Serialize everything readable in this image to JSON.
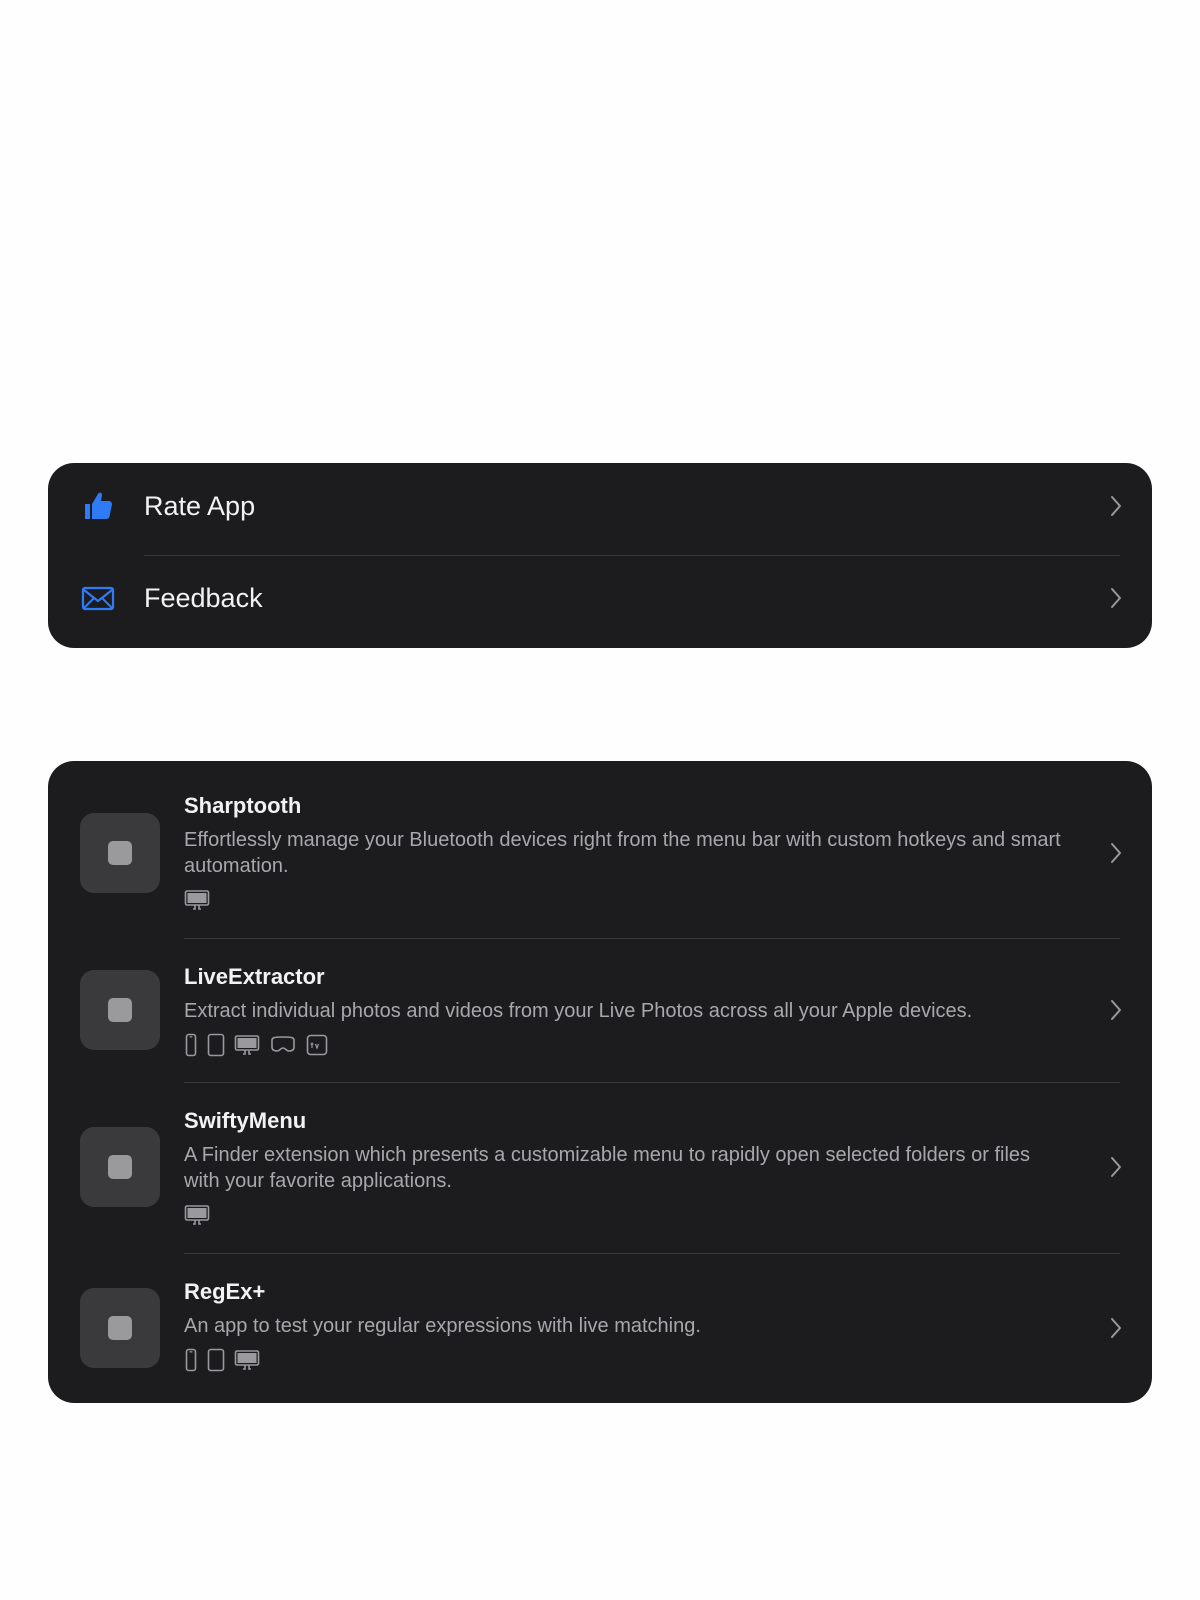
{
  "links": [
    {
      "label": "Rate App",
      "icon": "thumbs-up-icon",
      "color": "#2f7bf5"
    },
    {
      "label": "Feedback",
      "icon": "envelope-icon",
      "color": "#2f7bf5"
    }
  ],
  "apps": [
    {
      "name": "Sharptooth",
      "description": "Effortlessly manage your Bluetooth devices right from the menu bar with custom hotkeys and smart automation.",
      "platforms": [
        "mac"
      ]
    },
    {
      "name": "LiveExtractor",
      "description": "Extract individual photos and videos from your Live Photos across all your Apple devices.",
      "platforms": [
        "iphone",
        "ipad",
        "mac",
        "vision",
        "tv"
      ]
    },
    {
      "name": "SwiftyMenu",
      "description": "A Finder extension which presents a customizable menu to rapidly open selected folders or files with your favorite applications.",
      "platforms": [
        "mac"
      ]
    },
    {
      "name": "RegEx+",
      "description": "An app to test your regular expressions with live matching.",
      "platforms": [
        "iphone",
        "ipad",
        "mac"
      ]
    }
  ],
  "colors": {
    "background": "#fefefe",
    "card": "#1c1c1e",
    "accent": "#2f7bf5",
    "separator": "#38383a"
  }
}
